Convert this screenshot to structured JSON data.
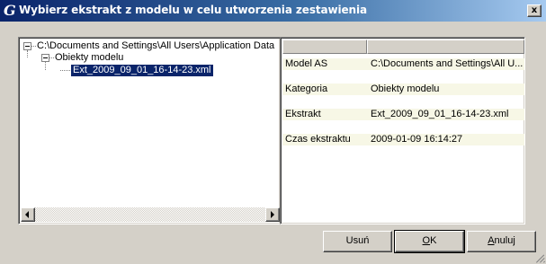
{
  "window": {
    "title": "Wybierz ekstrakt z modelu w celu utworzenia zestawienia",
    "app_icon": "G",
    "close_glyph": "x"
  },
  "tree": {
    "root": "C:\\Documents and Settings\\All Users\\Application Data",
    "child": "Obiekty modelu",
    "leaf": "Ext_2009_09_01_16-14-23.xml"
  },
  "properties": {
    "columns": [
      "",
      ""
    ],
    "rows": [
      {
        "key": "Model AS",
        "value": "C:\\Documents and Settings\\All U..."
      },
      {
        "key": "",
        "value": ""
      },
      {
        "key": "Kategoria",
        "value": "Obiekty modelu"
      },
      {
        "key": "",
        "value": ""
      },
      {
        "key": "Ekstrakt",
        "value": "Ext_2009_09_01_16-14-23.xml"
      },
      {
        "key": "",
        "value": ""
      },
      {
        "key": "Czas ekstraktu",
        "value": "2009-01-09 16:14:27"
      }
    ]
  },
  "buttons": {
    "delete": "Usuń",
    "ok": "OK",
    "cancel": "Anuluj"
  }
}
